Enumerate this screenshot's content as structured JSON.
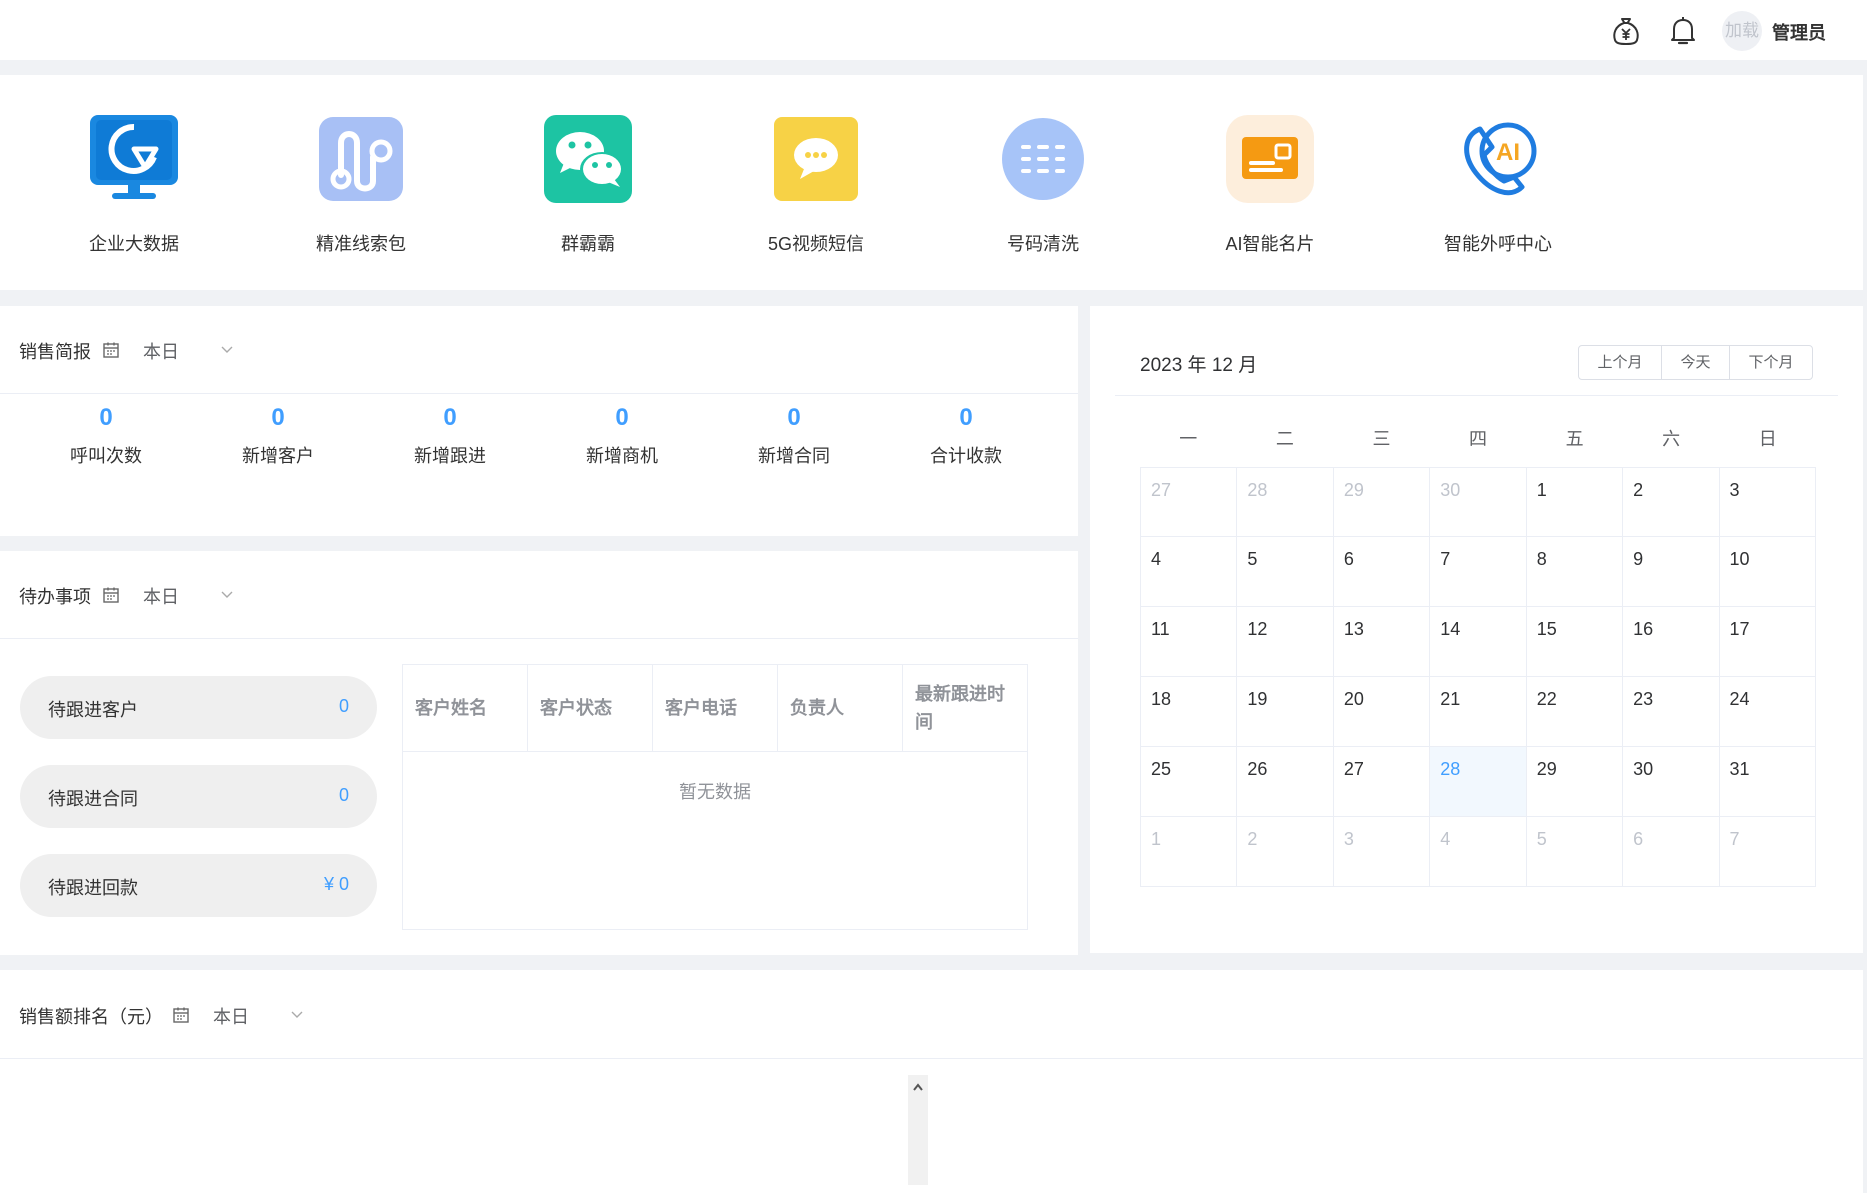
{
  "header": {
    "avatar_text": "加载",
    "username": "管理员",
    "icons": [
      "money-bag-icon",
      "bell-icon"
    ]
  },
  "apps": [
    {
      "label": "企业大数据",
      "icon": "monitor-chart-icon"
    },
    {
      "label": "精准线索包",
      "icon": "route-icon"
    },
    {
      "label": "群霸霸",
      "icon": "wechat-icon"
    },
    {
      "label": "5G视频短信",
      "icon": "message-bubble-icon"
    },
    {
      "label": "号码清洗",
      "icon": "keypad-icon"
    },
    {
      "label": "AI智能名片",
      "icon": "card-icon"
    },
    {
      "label": "智能外呼中心",
      "icon": "ai-phone-icon"
    }
  ],
  "sales_report": {
    "title": "销售简报",
    "range": "本日",
    "stats": [
      {
        "value": "0",
        "label": "呼叫次数"
      },
      {
        "value": "0",
        "label": "新增客户"
      },
      {
        "value": "0",
        "label": "新增跟进"
      },
      {
        "value": "0",
        "label": "新增商机"
      },
      {
        "value": "0",
        "label": "新增合同"
      },
      {
        "value": "0",
        "label": "合计收款"
      }
    ]
  },
  "todo": {
    "title": "待办事项",
    "range": "本日",
    "pills": [
      {
        "label": "待跟进客户",
        "value": "0"
      },
      {
        "label": "待跟进合同",
        "value": "0"
      },
      {
        "label": "待跟进回款",
        "value": "¥ 0"
      }
    ],
    "table": {
      "columns": [
        "客户姓名",
        "客户状态",
        "客户电话",
        "负责人",
        "最新跟进时间"
      ],
      "empty_text": "暂无数据"
    }
  },
  "calendar": {
    "title": "2023 年 12 月",
    "buttons": [
      "上个月",
      "今天",
      "下个月"
    ],
    "weekdays": [
      "一",
      "二",
      "三",
      "四",
      "五",
      "六",
      "日"
    ],
    "today": "28",
    "weeks": [
      [
        {
          "d": "27",
          "o": true
        },
        {
          "d": "28",
          "o": true
        },
        {
          "d": "29",
          "o": true
        },
        {
          "d": "30",
          "o": true
        },
        {
          "d": "1"
        },
        {
          "d": "2"
        },
        {
          "d": "3"
        }
      ],
      [
        {
          "d": "4"
        },
        {
          "d": "5"
        },
        {
          "d": "6"
        },
        {
          "d": "7"
        },
        {
          "d": "8"
        },
        {
          "d": "9"
        },
        {
          "d": "10"
        }
      ],
      [
        {
          "d": "11"
        },
        {
          "d": "12"
        },
        {
          "d": "13"
        },
        {
          "d": "14"
        },
        {
          "d": "15"
        },
        {
          "d": "16"
        },
        {
          "d": "17"
        }
      ],
      [
        {
          "d": "18"
        },
        {
          "d": "19"
        },
        {
          "d": "20"
        },
        {
          "d": "21"
        },
        {
          "d": "22"
        },
        {
          "d": "23"
        },
        {
          "d": "24"
        }
      ],
      [
        {
          "d": "25"
        },
        {
          "d": "26"
        },
        {
          "d": "27"
        },
        {
          "d": "28",
          "t": true
        },
        {
          "d": "29"
        },
        {
          "d": "30"
        },
        {
          "d": "31"
        }
      ],
      [
        {
          "d": "1",
          "o": true
        },
        {
          "d": "2",
          "o": true
        },
        {
          "d": "3",
          "o": true
        },
        {
          "d": "4",
          "o": true
        },
        {
          "d": "5",
          "o": true
        },
        {
          "d": "6",
          "o": true
        },
        {
          "d": "7",
          "o": true
        }
      ]
    ]
  },
  "ranking": {
    "title": "销售额排名（元）",
    "range": "本日"
  },
  "colors": {
    "accent": "#409eff",
    "page_bg": "#f0f2f5",
    "pill_bg": "#efefef"
  }
}
